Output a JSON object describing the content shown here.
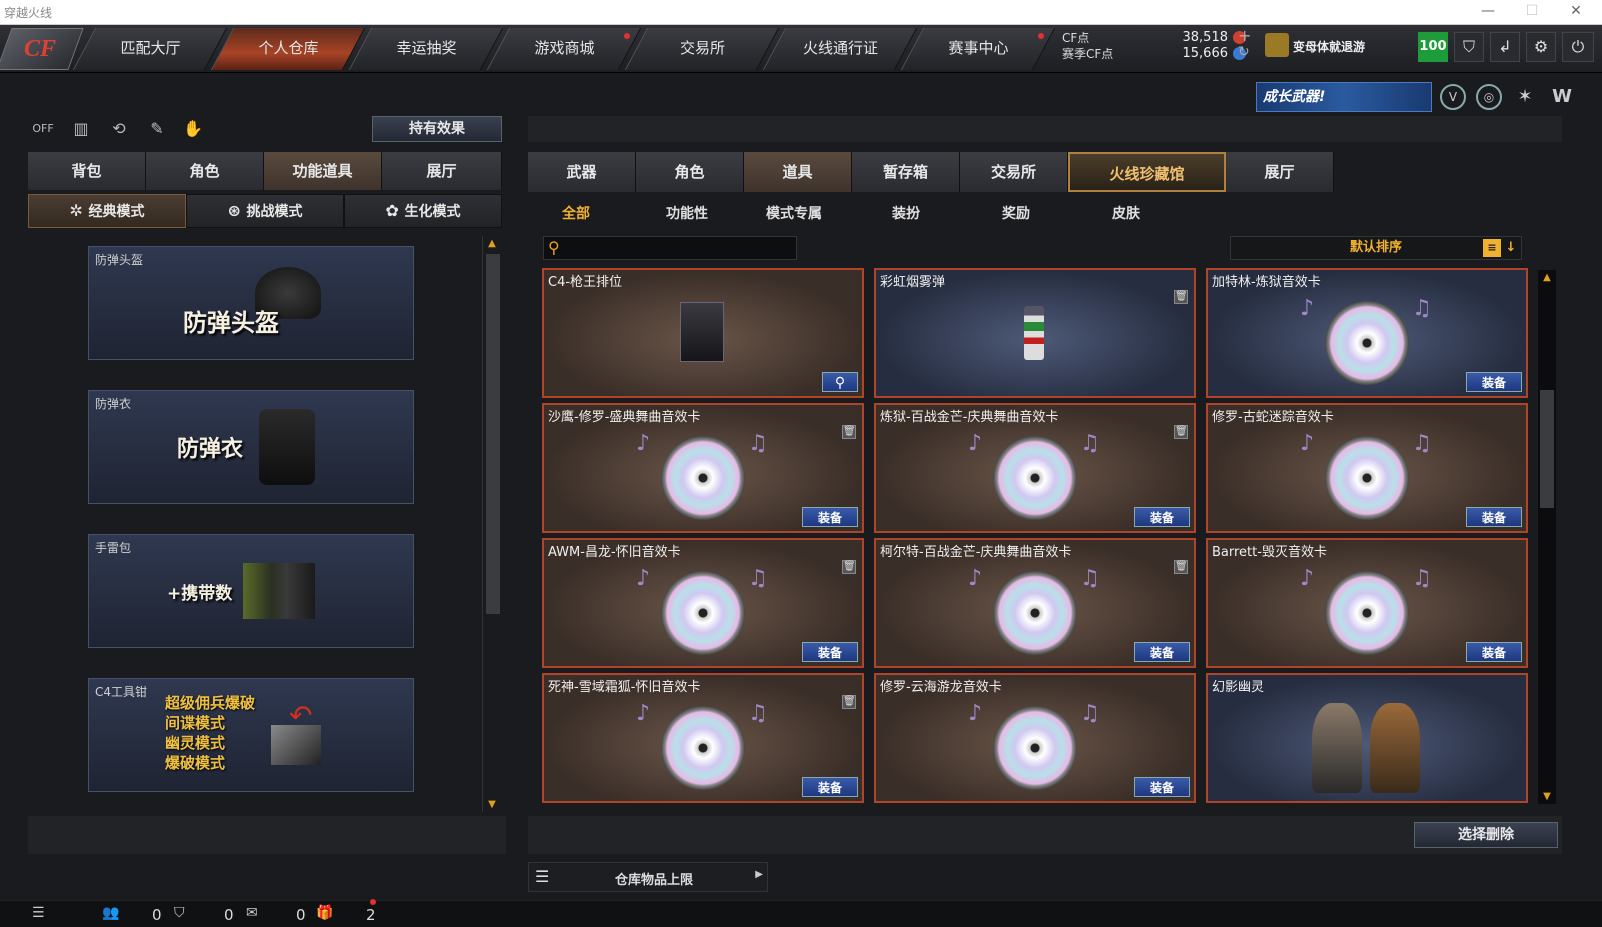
{
  "window": {
    "title": "穿越火线"
  },
  "nav": {
    "logo": "CF",
    "tabs": [
      "匹配大厅",
      "个人仓库",
      "幸运抽奖",
      "游戏商城",
      "交易所",
      "火线通行证",
      "赛事中心"
    ],
    "active": "个人仓库"
  },
  "currency": {
    "cf_label": "CF点",
    "cf_value": "38,518",
    "season_label": "赛季CF点",
    "season_value": "15,666"
  },
  "user": {
    "name": "变母体就退游",
    "level": "100"
  },
  "promo": {
    "banner": "成长武器!"
  },
  "left": {
    "effects_button": "持有效果",
    "tabs": [
      "背包",
      "角色",
      "功能道具",
      "展厅"
    ],
    "active_tab": "功能道具",
    "modes": [
      "经典模式",
      "挑战模式",
      "生化模式"
    ],
    "active_mode": "经典模式",
    "cards": [
      {
        "label": "防弹头盔",
        "title": "防弹头盔"
      },
      {
        "label": "防弹衣",
        "title": "防弹衣"
      },
      {
        "label": "手雷包",
        "title": "+携带数"
      },
      {
        "label": "C4工具钳",
        "lines": [
          "超级佣兵爆破",
          "间谍模式",
          "幽灵模式",
          "爆破模式"
        ]
      }
    ]
  },
  "right": {
    "tabs": [
      "武器",
      "角色",
      "道具",
      "暂存箱",
      "交易所",
      "火线珍藏馆",
      "展厅"
    ],
    "active_tab": "道具",
    "subtabs": [
      "全部",
      "功能性",
      "模式专属",
      "装扮",
      "奖励",
      "皮肤"
    ],
    "active_subtab": "全部",
    "search_placeholder": "",
    "sort_label": "默认排序",
    "equip_label": "装备",
    "items": [
      {
        "name": "C4-枪王排位",
        "bg": "brown",
        "type": "c4",
        "action": "search"
      },
      {
        "name": "彩虹烟雾弹",
        "bg": "blue",
        "type": "grenade",
        "delete": true
      },
      {
        "name": "加特林-炼狱音效卡",
        "bg": "blue",
        "type": "cd",
        "equip": true
      },
      {
        "name": "沙鹰-修罗-盛典舞曲音效卡",
        "bg": "brown",
        "type": "cd",
        "equip": true,
        "delete": true
      },
      {
        "name": "炼狱-百战金芒-庆典舞曲音效卡",
        "bg": "brown",
        "type": "cd",
        "equip": true,
        "delete": true
      },
      {
        "name": "修罗-古蛇迷踪音效卡",
        "bg": "brown",
        "type": "cd",
        "equip": true
      },
      {
        "name": "AWM-昌龙-怀旧音效卡",
        "bg": "brown",
        "type": "cd",
        "equip": true,
        "delete": true
      },
      {
        "name": "柯尔特-百战金芒-庆典舞曲音效卡",
        "bg": "brown",
        "type": "cd",
        "equip": true,
        "delete": true
      },
      {
        "name": "Barrett-毁灭音效卡",
        "bg": "brown",
        "type": "cd",
        "equip": true
      },
      {
        "name": "死神-雪域霜狐-怀旧音效卡",
        "bg": "brown",
        "type": "cd",
        "equip": true,
        "delete": true
      },
      {
        "name": "修罗-云海游龙音效卡",
        "bg": "brown",
        "type": "cd",
        "equip": true
      },
      {
        "name": "幻影幽灵",
        "bg": "blue",
        "type": "chars"
      }
    ],
    "select_delete": "选择删除",
    "capacity_label": "仓库物品上限"
  },
  "footer": {
    "counts": [
      "0",
      "0",
      "0",
      "2"
    ]
  }
}
